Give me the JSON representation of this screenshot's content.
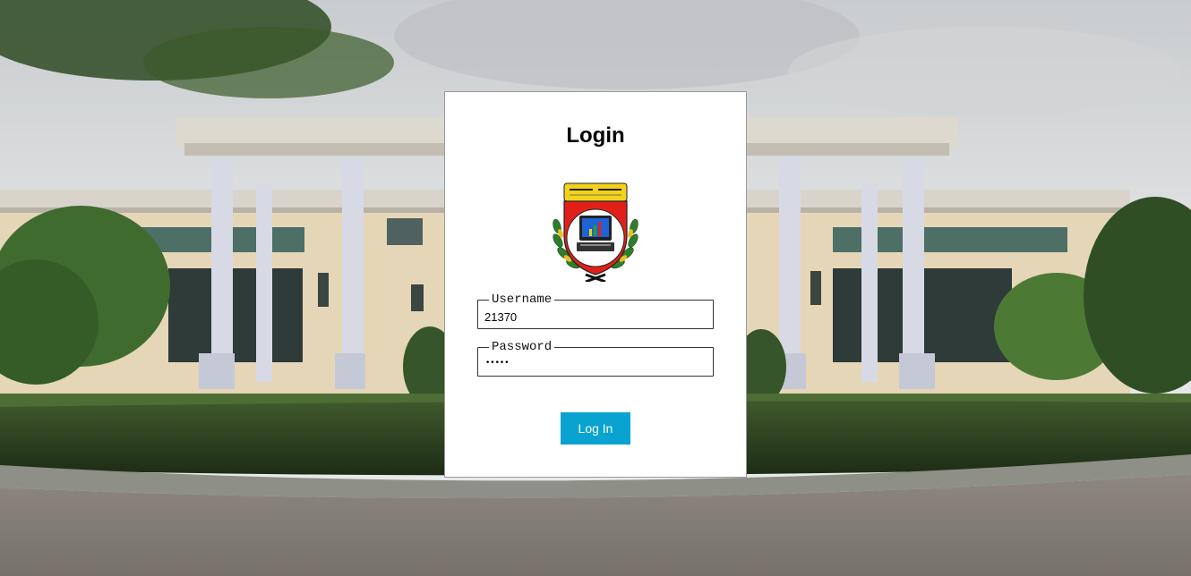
{
  "page": {
    "title": "Login"
  },
  "form": {
    "username_legend": "Username",
    "username_value": "21370",
    "password_legend": "Password",
    "password_masked": "•••••",
    "submit_label": "Log In"
  },
  "logo": {
    "icon": "university-emblem-icon"
  },
  "colors": {
    "button_bg": "#0aa3d1",
    "button_text": "#ffffff",
    "card_bg": "#ffffff"
  }
}
